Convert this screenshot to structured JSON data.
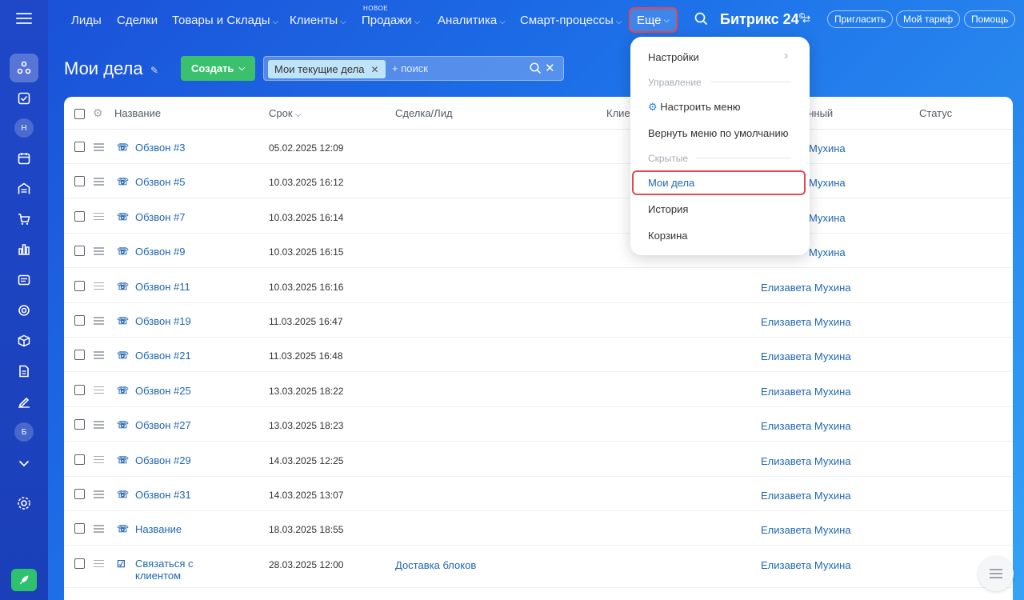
{
  "sidebar": {
    "avatar_top": "Н",
    "avatar_bottom": "Б",
    "icons": [
      "activity-icon",
      "tasks-icon",
      "calendar-icon",
      "warehouse-icon",
      "cart-icon",
      "analytics-icon",
      "contacts-icon",
      "target-icon",
      "box-icon",
      "document-icon",
      "sign-icon",
      "chevron-down-icon",
      "settings-icon"
    ]
  },
  "topnav": {
    "items": [
      {
        "label": "Лиды"
      },
      {
        "label": "Сделки"
      },
      {
        "label": "Товары и Склады"
      },
      {
        "label": "Клиенты"
      },
      {
        "label": "Продажи"
      },
      {
        "label": "Аналитика"
      },
      {
        "label": "Смарт-процессы"
      }
    ],
    "new_badge": "НОВОЕ",
    "more_label": "Еще",
    "brand": "Битрикс 24",
    "invite_label": "Пригласить",
    "tariff_label": "Мой тариф",
    "help_label": "Помощь"
  },
  "header": {
    "title": "Мои дела",
    "create_label": "Создать",
    "filter_tag": "Мои текущие дела",
    "search_placeholder": "+ поиск"
  },
  "table": {
    "columns": {
      "name": "Название",
      "deadline": "Срок",
      "deal": "Сделка/Лид",
      "client": "Клие",
      "responsible": "енный",
      "status": "Статус"
    },
    "rows": [
      {
        "title": "Обзвон #3",
        "date": "05.02.2025 12:09",
        "deal": "",
        "responsible": "Мухина"
      },
      {
        "title": "Обзвон #5",
        "date": "10.03.2025 16:12",
        "deal": "",
        "responsible": "Мухина"
      },
      {
        "title": "Обзвон #7",
        "date": "10.03.2025 16:14",
        "deal": "",
        "responsible": "Мухина"
      },
      {
        "title": "Обзвон #9",
        "date": "10.03.2025 16:15",
        "deal": "",
        "responsible": "Мухина"
      },
      {
        "title": "Обзвон #11",
        "date": "10.03.2025 16:16",
        "deal": "",
        "responsible": "Елизавета Мухина"
      },
      {
        "title": "Обзвон #19",
        "date": "11.03.2025 16:47",
        "deal": "",
        "responsible": "Елизавета Мухина"
      },
      {
        "title": "Обзвон #21",
        "date": "11.03.2025 16:48",
        "deal": "",
        "responsible": "Елизавета Мухина"
      },
      {
        "title": "Обзвон #25",
        "date": "13.03.2025 18:22",
        "deal": "",
        "responsible": "Елизавета Мухина"
      },
      {
        "title": "Обзвон #27",
        "date": "13.03.2025 18:23",
        "deal": "",
        "responsible": "Елизавета Мухина"
      },
      {
        "title": "Обзвон #29",
        "date": "14.03.2025 12:25",
        "deal": "",
        "responsible": "Елизавета Мухина"
      },
      {
        "title": "Обзвон #31",
        "date": "14.03.2025 13:07",
        "deal": "",
        "responsible": "Елизавета Мухина"
      },
      {
        "title": "Название",
        "date": "18.03.2025 18:55",
        "deal": "",
        "responsible": "Елизавета Мухина"
      },
      {
        "title": "Связаться с клиентом",
        "date": "28.03.2025 12:00",
        "deal": "Доставка блоков",
        "responsible": "Елизавета Мухина"
      }
    ]
  },
  "dropdown": {
    "settings": "Настройки",
    "section_manage": "Управление",
    "configure_menu": "Настроить меню",
    "reset_menu": "Вернуть меню по умолчанию",
    "section_hidden": "Скрытые",
    "my_tasks": "Мои дела",
    "history": "История",
    "trash": "Корзина"
  },
  "colors": {
    "accent": "#2067b0",
    "create": "#3bc16d",
    "highlight": "#e04a52"
  }
}
